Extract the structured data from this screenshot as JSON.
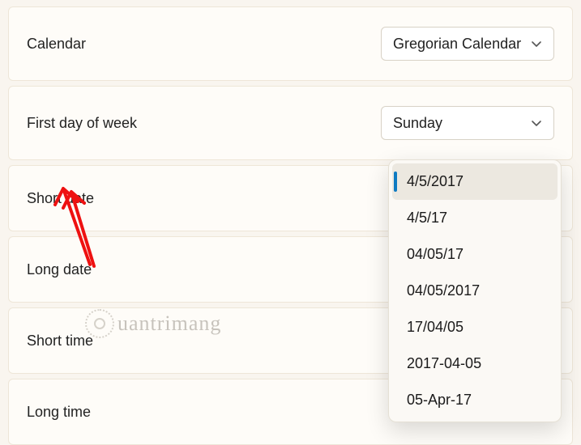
{
  "rows": {
    "calendar": {
      "label": "Calendar",
      "value": "Gregorian Calendar"
    },
    "first_day": {
      "label": "First day of week",
      "value": "Sunday"
    },
    "short_date": {
      "label": "Short date"
    },
    "long_date": {
      "label": "Long date"
    },
    "short_time": {
      "label": "Short time"
    },
    "long_time": {
      "label": "Long time"
    }
  },
  "short_date_options": [
    "4/5/2017",
    "4/5/17",
    "04/05/17",
    "04/05/2017",
    "17/04/05",
    "2017-04-05",
    "05-Apr-17"
  ],
  "short_date_selected_index": 0,
  "watermark": "uantrimang"
}
